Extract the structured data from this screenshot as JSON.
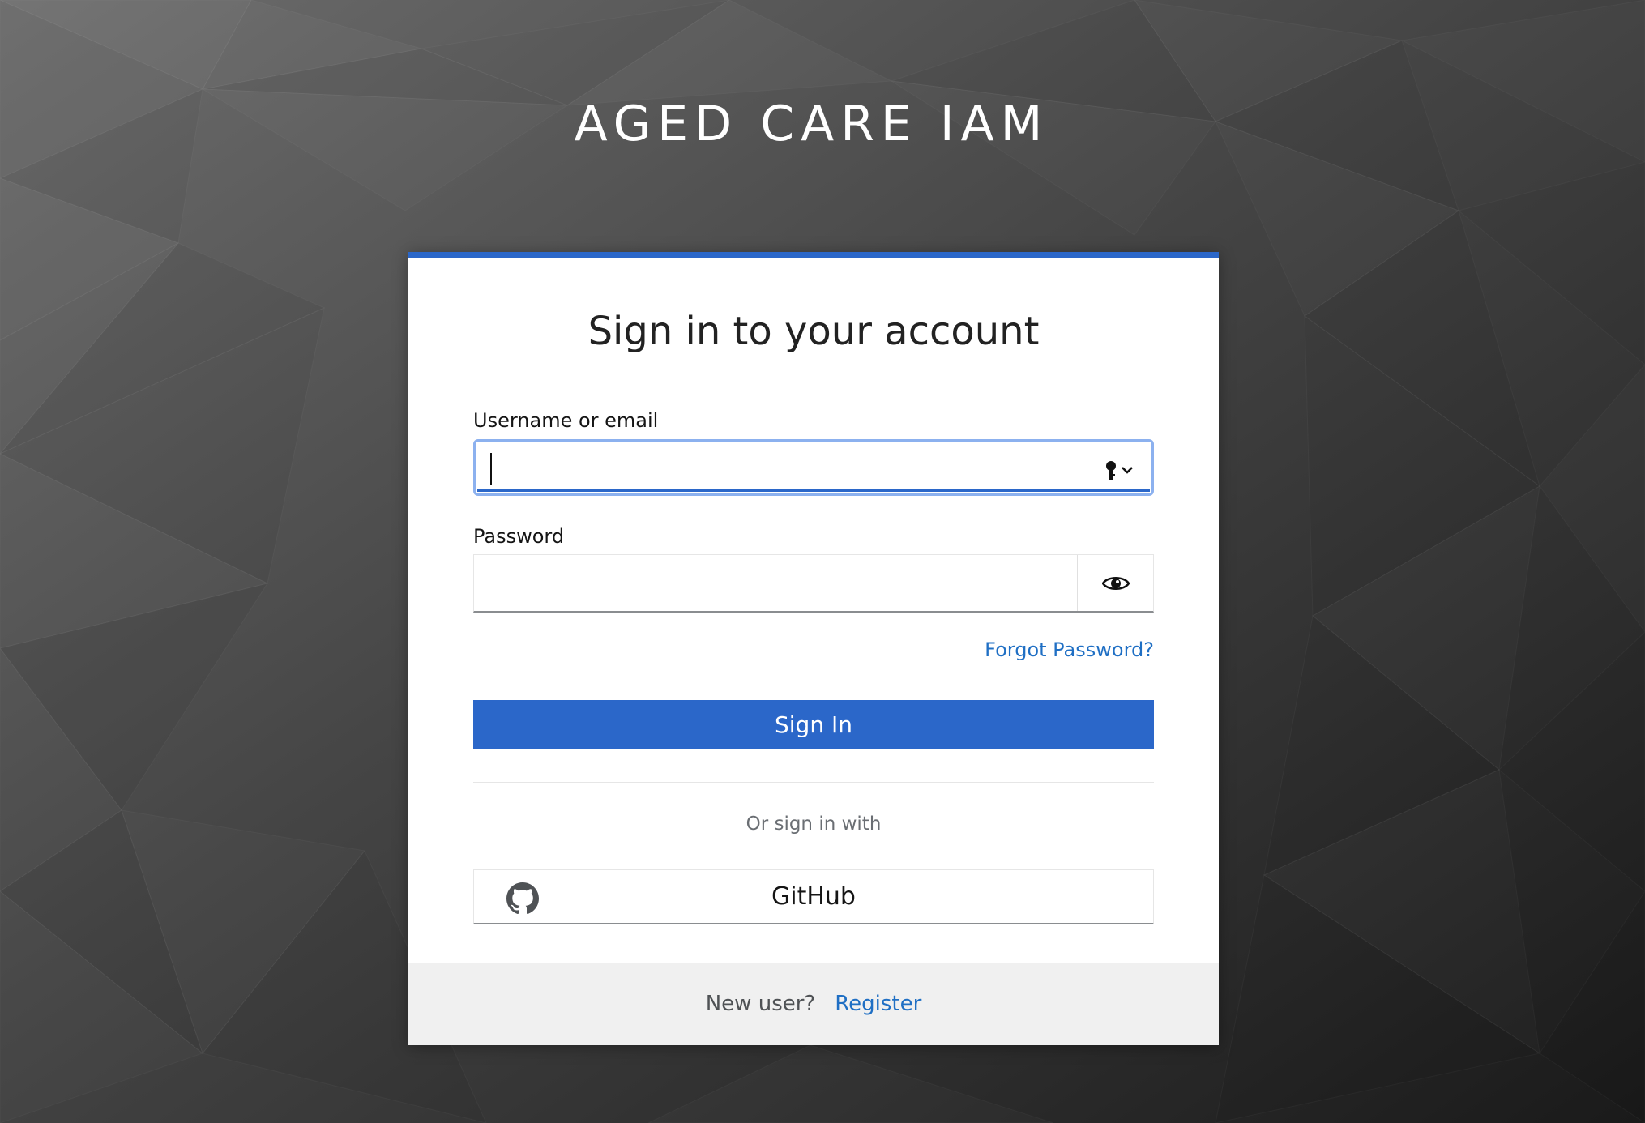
{
  "realm": {
    "title": "AGED CARE IAM"
  },
  "login": {
    "heading": "Sign in to your account",
    "username_label": "Username or email",
    "username_value": "",
    "password_label": "Password",
    "password_value": "",
    "forgot_password": "Forgot Password?",
    "sign_in_button": "Sign In"
  },
  "social": {
    "or_text": "Or sign in with",
    "providers": [
      {
        "label": "GitHub",
        "icon": "github-icon"
      }
    ]
  },
  "footer": {
    "new_user_text": "New user?",
    "register_link": "Register"
  },
  "icons": {
    "username_field": "password-manager-key-icon",
    "password_toggle": "eye-icon"
  },
  "colors": {
    "primary": "#2b67c9",
    "link": "#1f6fc4",
    "focus_ring": "#8cb1ef",
    "footer_bg": "#f0f0f0"
  }
}
